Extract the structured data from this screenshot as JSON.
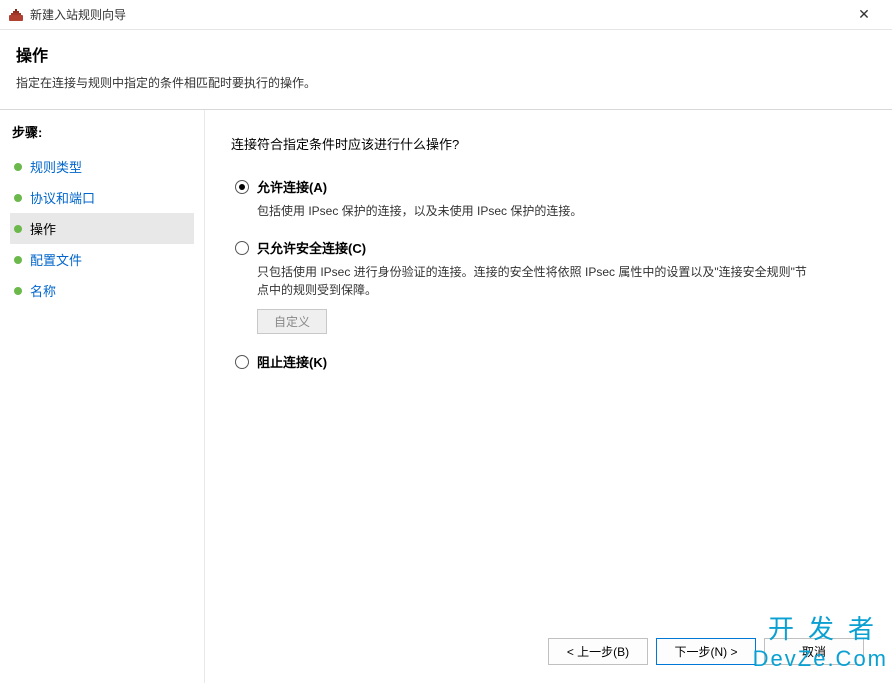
{
  "window": {
    "title": "新建入站规则向导",
    "close_glyph": "✕"
  },
  "header": {
    "title": "操作",
    "subtitle": "指定在连接与规则中指定的条件相匹配时要执行的操作。"
  },
  "sidebar": {
    "title": "步骤:",
    "items": [
      {
        "label": "规则类型",
        "current": false
      },
      {
        "label": "协议和端口",
        "current": false
      },
      {
        "label": "操作",
        "current": true
      },
      {
        "label": "配置文件",
        "current": false
      },
      {
        "label": "名称",
        "current": false
      }
    ]
  },
  "main": {
    "prompt": "连接符合指定条件时应该进行什么操作?",
    "options": [
      {
        "label": "允许连接(A)",
        "desc": "包括使用 IPsec 保护的连接，以及未使用 IPsec 保护的连接。",
        "selected": true
      },
      {
        "label": "只允许安全连接(C)",
        "desc": "只包括使用 IPsec 进行身份验证的连接。连接的安全性将依照 IPsec 属性中的设置以及\"连接安全规则\"节点中的规则受到保障。",
        "selected": false,
        "custom_button": "自定义"
      },
      {
        "label": "阻止连接(K)",
        "selected": false
      }
    ]
  },
  "footer": {
    "back": "< 上一步(B)",
    "next": "下一步(N) >",
    "cancel": "取消"
  },
  "watermark": {
    "line1": "开发者",
    "line2": "DevZe.Com"
  }
}
